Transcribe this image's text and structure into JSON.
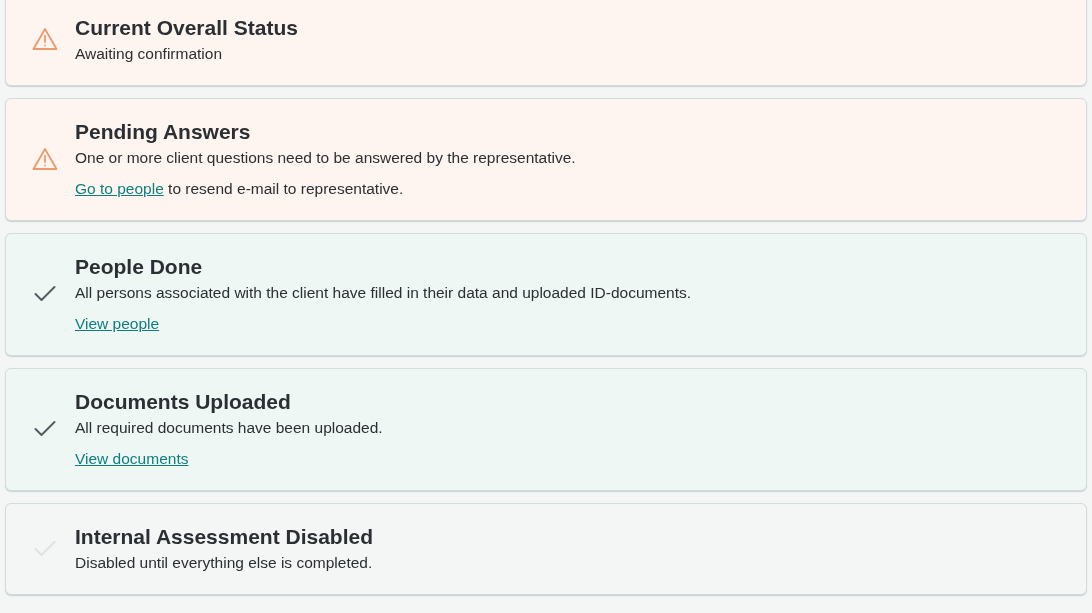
{
  "cards": [
    {
      "kind": "warning",
      "title": "Current Overall Status",
      "description": "Awaiting confirmation"
    },
    {
      "kind": "warning",
      "title": "Pending Answers",
      "description": "One or more client questions need to be answered by the representative.",
      "link": {
        "text": "Go to people",
        "after": " to resend e-mail to representative."
      }
    },
    {
      "kind": "done",
      "title": "People Done",
      "description": "All persons associated with the client have filled in their data and uploaded ID-documents.",
      "link": {
        "text": "View people"
      }
    },
    {
      "kind": "done",
      "title": "Documents Uploaded",
      "description": "All required documents have been uploaded.",
      "link": {
        "text": "View documents"
      }
    },
    {
      "kind": "disabled",
      "title": "Internal Assessment Disabled",
      "description": "Disabled until everything else is completed."
    }
  ]
}
